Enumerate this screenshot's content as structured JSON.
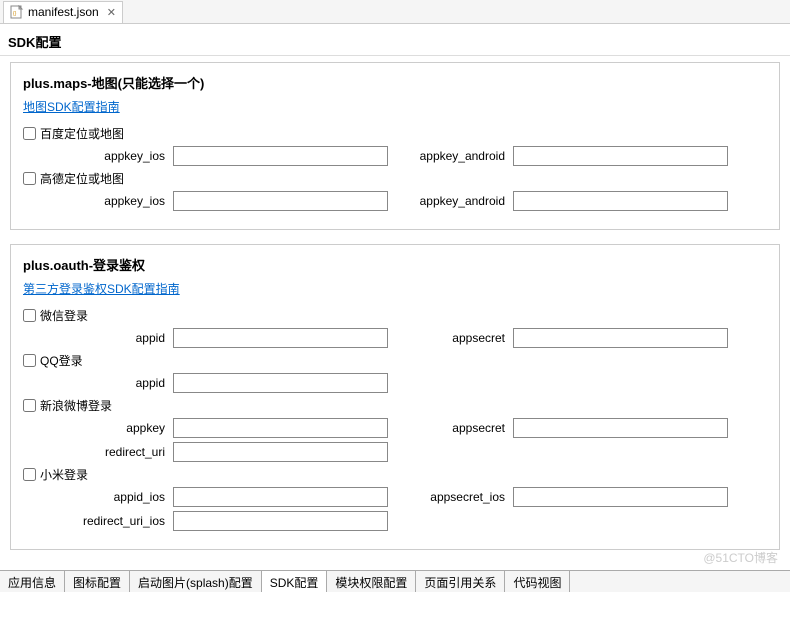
{
  "tab": {
    "filename": "manifest.json"
  },
  "page_title": "SDK配置",
  "maps": {
    "title": "plus.maps-地图(只能选择一个)",
    "guide_link": "地图SDK配置指南",
    "baidu_label": "百度定位或地图",
    "amap_label": "高德定位或地图",
    "appkey_ios_label": "appkey_ios",
    "appkey_android_label": "appkey_android"
  },
  "oauth": {
    "title": "plus.oauth-登录鉴权",
    "guide_link": "第三方登录鉴权SDK配置指南",
    "wechat_label": "微信登录",
    "qq_label": "QQ登录",
    "weibo_label": "新浪微博登录",
    "xiaomi_label": "小米登录",
    "appid_label": "appid",
    "appsecret_label": "appsecret",
    "appkey_label": "appkey",
    "redirect_uri_label": "redirect_uri",
    "appid_ios_label": "appid_ios",
    "appsecret_ios_label": "appsecret_ios",
    "redirect_uri_ios_label": "redirect_uri_ios"
  },
  "bottom_tabs": {
    "t0": "应用信息",
    "t1": "图标配置",
    "t2": "启动图片(splash)配置",
    "t3": "SDK配置",
    "t4": "模块权限配置",
    "t5": "页面引用关系",
    "t6": "代码视图"
  },
  "watermark": "@51CTO博客"
}
